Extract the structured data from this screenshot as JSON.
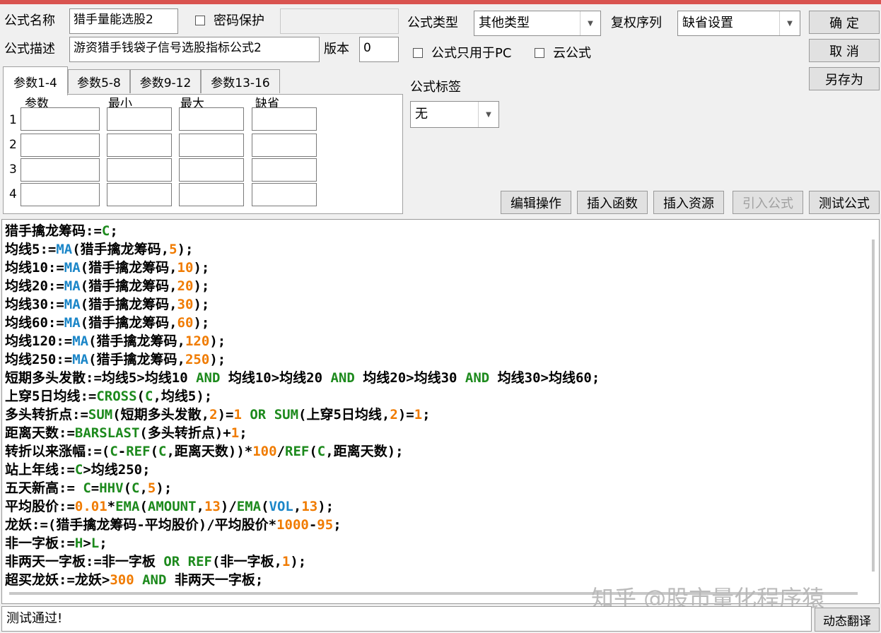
{
  "form": {
    "name_label": "公式名称",
    "name_value": "猎手量能选股2",
    "password_label": "密码保护",
    "desc_label": "公式描述",
    "desc_value": "游资猎手钱袋子信号选股指标公式2",
    "version_label": "版本",
    "version_value": "0",
    "type_label": "公式类型",
    "type_value": "其他类型",
    "fq_label": "复权序列",
    "fq_value": "缺省设置",
    "pc_only_label": "公式只用于PC",
    "cloud_label": "云公式",
    "tag_label": "公式标签",
    "tag_value": "无"
  },
  "buttons": {
    "ok": "确  定",
    "cancel": "取  消",
    "save_as": "另存为",
    "edit_ops": "编辑操作",
    "insert_func": "插入函数",
    "insert_res": "插入资源",
    "import_formula": "引入公式",
    "test_formula": "测试公式",
    "dynamic_translate": "动态翻译"
  },
  "params": {
    "tabs": [
      "参数1-4",
      "参数5-8",
      "参数9-12",
      "参数13-16"
    ],
    "headers": [
      "参数",
      "最小",
      "最大",
      "缺省"
    ],
    "rows": [
      "1",
      "2",
      "3",
      "4"
    ]
  },
  "code_lines": [
    [
      [
        "t",
        "猎手擒龙筹码:="
      ],
      [
        "cv",
        "C"
      ],
      [
        "t",
        ";"
      ]
    ],
    [
      [
        "t",
        "均线5:="
      ],
      [
        "fn",
        "MA"
      ],
      [
        "t",
        "(猎手擒龙筹码,"
      ],
      [
        "num",
        "5"
      ],
      [
        "t",
        ");"
      ]
    ],
    [
      [
        "t",
        "均线10:="
      ],
      [
        "fn",
        "MA"
      ],
      [
        "t",
        "(猎手擒龙筹码,"
      ],
      [
        "num",
        "10"
      ],
      [
        "t",
        ");"
      ]
    ],
    [
      [
        "t",
        "均线20:="
      ],
      [
        "fn",
        "MA"
      ],
      [
        "t",
        "(猎手擒龙筹码,"
      ],
      [
        "num",
        "20"
      ],
      [
        "t",
        ");"
      ]
    ],
    [
      [
        "t",
        "均线30:="
      ],
      [
        "fn",
        "MA"
      ],
      [
        "t",
        "(猎手擒龙筹码,"
      ],
      [
        "num",
        "30"
      ],
      [
        "t",
        ");"
      ]
    ],
    [
      [
        "t",
        "均线60:="
      ],
      [
        "fn",
        "MA"
      ],
      [
        "t",
        "(猎手擒龙筹码,"
      ],
      [
        "num",
        "60"
      ],
      [
        "t",
        ");"
      ]
    ],
    [
      [
        "t",
        "均线120:="
      ],
      [
        "fn",
        "MA"
      ],
      [
        "t",
        "(猎手擒龙筹码,"
      ],
      [
        "num",
        "120"
      ],
      [
        "t",
        ");"
      ]
    ],
    [
      [
        "t",
        "均线250:="
      ],
      [
        "fn",
        "MA"
      ],
      [
        "t",
        "(猎手擒龙筹码,"
      ],
      [
        "num",
        "250"
      ],
      [
        "t",
        ");"
      ]
    ],
    [
      [
        "t",
        "短期多头发散:=均线5>均线10 "
      ],
      [
        "kw",
        "AND"
      ],
      [
        "t",
        " 均线10>均线20 "
      ],
      [
        "kw",
        "AND"
      ],
      [
        "t",
        " 均线20>均线30 "
      ],
      [
        "kw",
        "AND"
      ],
      [
        "t",
        " 均线30>均线60;"
      ]
    ],
    [
      [
        "t",
        "上穿5日均线:="
      ],
      [
        "kw",
        "CROSS"
      ],
      [
        "t",
        "("
      ],
      [
        "cv",
        "C"
      ],
      [
        "t",
        ",均线5);"
      ]
    ],
    [
      [
        "t",
        "多头转折点:="
      ],
      [
        "kw",
        "SUM"
      ],
      [
        "t",
        "(短期多头发散,"
      ],
      [
        "num",
        "2"
      ],
      [
        "t",
        ")="
      ],
      [
        "num",
        "1"
      ],
      [
        "t",
        " "
      ],
      [
        "kw",
        "OR"
      ],
      [
        "t",
        " "
      ],
      [
        "kw",
        "SUM"
      ],
      [
        "t",
        "(上穿5日均线,"
      ],
      [
        "num",
        "2"
      ],
      [
        "t",
        ")="
      ],
      [
        "num",
        "1"
      ],
      [
        "t",
        ";"
      ]
    ],
    [
      [
        "t",
        "距离天数:="
      ],
      [
        "kw",
        "BARSLAST"
      ],
      [
        "t",
        "(多头转折点)+"
      ],
      [
        "num",
        "1"
      ],
      [
        "t",
        ";"
      ]
    ],
    [
      [
        "t",
        "转折以来涨幅:=("
      ],
      [
        "cv",
        "C"
      ],
      [
        "t",
        "-"
      ],
      [
        "kw",
        "REF"
      ],
      [
        "t",
        "("
      ],
      [
        "cv",
        "C"
      ],
      [
        "t",
        ",距离天数))*"
      ],
      [
        "num",
        "100"
      ],
      [
        "t",
        "/"
      ],
      [
        "kw",
        "REF"
      ],
      [
        "t",
        "("
      ],
      [
        "cv",
        "C"
      ],
      [
        "t",
        ",距离天数);"
      ]
    ],
    [
      [
        "t",
        "站上年线:="
      ],
      [
        "cv",
        "C"
      ],
      [
        "t",
        ">均线250;"
      ]
    ],
    [
      [
        "t",
        "五天新高:= "
      ],
      [
        "cv",
        "C"
      ],
      [
        "t",
        "="
      ],
      [
        "kw",
        "HHV"
      ],
      [
        "t",
        "("
      ],
      [
        "cv",
        "C"
      ],
      [
        "t",
        ","
      ],
      [
        "num",
        "5"
      ],
      [
        "t",
        ");"
      ]
    ],
    [
      [
        "t",
        "平均股价:="
      ],
      [
        "num",
        "0.01"
      ],
      [
        "t",
        "*"
      ],
      [
        "kw",
        "EMA"
      ],
      [
        "t",
        "("
      ],
      [
        "kw",
        "AMOUNT"
      ],
      [
        "t",
        ","
      ],
      [
        "num",
        "13"
      ],
      [
        "t",
        ")/"
      ],
      [
        "kw",
        "EMA"
      ],
      [
        "t",
        "("
      ],
      [
        "fn",
        "VOL"
      ],
      [
        "t",
        ","
      ],
      [
        "num",
        "13"
      ],
      [
        "t",
        ");"
      ]
    ],
    [
      [
        "t",
        "龙妖:=(猎手擒龙筹码-平均股价)/平均股价*"
      ],
      [
        "num",
        "1000"
      ],
      [
        "t",
        "-"
      ],
      [
        "num",
        "95"
      ],
      [
        "t",
        ";"
      ]
    ],
    [
      [
        "t",
        "非一字板:="
      ],
      [
        "cv",
        "H"
      ],
      [
        "t",
        ">"
      ],
      [
        "cv",
        "L"
      ],
      [
        "t",
        ";"
      ]
    ],
    [
      [
        "t",
        "非两天一字板:=非一字板 "
      ],
      [
        "kw",
        "OR"
      ],
      [
        "t",
        " "
      ],
      [
        "kw",
        "REF"
      ],
      [
        "t",
        "(非一字板,"
      ],
      [
        "num",
        "1"
      ],
      [
        "t",
        ");"
      ]
    ],
    [
      [
        "t",
        "超买龙妖:=龙妖>"
      ],
      [
        "num",
        "300"
      ],
      [
        "t",
        " "
      ],
      [
        "kw",
        "AND"
      ],
      [
        "t",
        " 非两天一字板;"
      ]
    ]
  ],
  "status_text": "测试通过!",
  "watermark": "知乎 @股市量化程序猿"
}
